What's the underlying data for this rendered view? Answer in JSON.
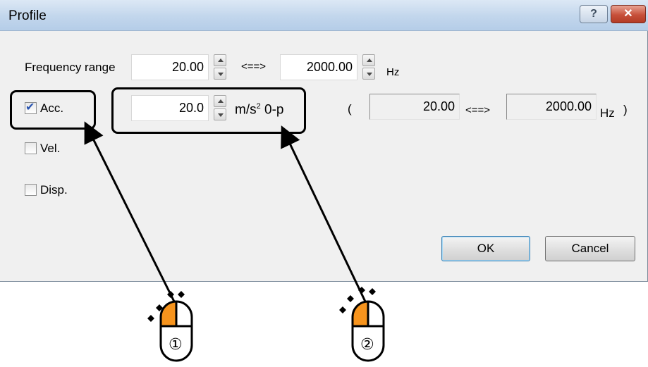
{
  "dialog": {
    "title": "Profile",
    "help_glyph": "?",
    "close_glyph": "✕",
    "frequency_range_label": "Frequency range",
    "freq_min": "20.00",
    "range_separator": "<==>",
    "freq_max": "2000.00",
    "freq_unit": "Hz",
    "checkboxes": [
      {
        "label": "Acc.",
        "checked": true
      },
      {
        "label": "Vel.",
        "checked": false
      },
      {
        "label": "Disp.",
        "checked": false
      }
    ],
    "level_value": "20.0",
    "level_unit": "m/s",
    "level_unit_sup": "2",
    "level_suffix": "0-p",
    "result_open": "(",
    "result_min": "20.00",
    "result_separator": "<==>",
    "result_max": "2000.00",
    "result_unit": "Hz",
    "result_close": ")",
    "ok_label": "OK",
    "cancel_label": "Cancel"
  },
  "annotations": {
    "step1": "①",
    "step2": "②",
    "mouse_button_color": "#f7941d"
  }
}
